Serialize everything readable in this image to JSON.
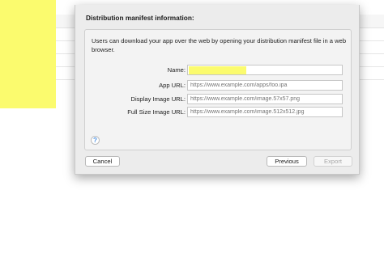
{
  "dialog": {
    "title": "Distribution manifest information:",
    "intro": "Users can download your app over the web by opening your distribution manifest file in a web browser.",
    "fields": [
      {
        "label": "Name:",
        "value": "",
        "placeholder": ""
      },
      {
        "label": "App URL:",
        "value": "",
        "placeholder": "https://www.example.com/apps/foo.ipa"
      },
      {
        "label": "Display Image URL:",
        "value": "",
        "placeholder": "https://www.example.com/image.57x57.png"
      },
      {
        "label": "Full Size Image URL:",
        "value": "",
        "placeholder": "https://www.example.com/image.512x512.jpg"
      }
    ],
    "help_glyph": "?",
    "buttons": {
      "cancel": "Cancel",
      "previous": "Previous",
      "export": "Export"
    }
  },
  "colors": {
    "highlight": "#fbfb6e",
    "help_accent": "#4a90e2",
    "disabled_text": "#a8a8a8"
  }
}
